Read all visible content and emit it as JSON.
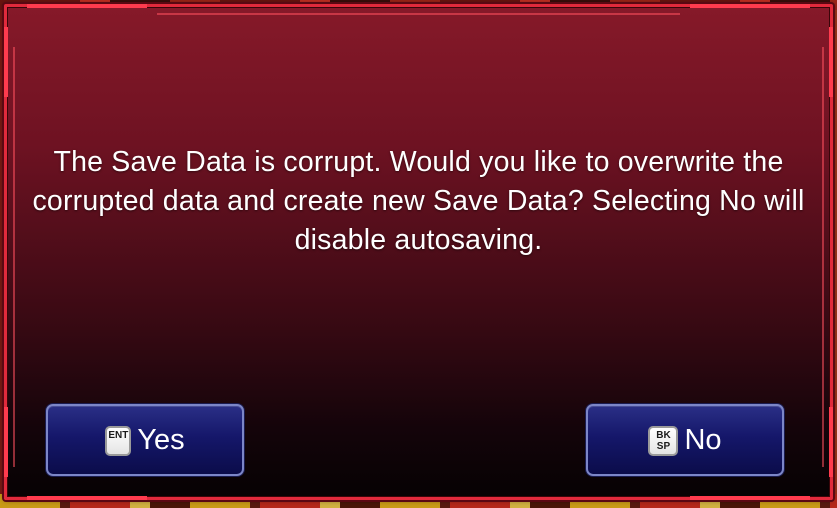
{
  "dialog": {
    "message": "The Save Data is corrupt. Would you like to overwrite the corrupted data and create new Save Data? Selecting No will disable autosaving.",
    "buttons": {
      "yes": {
        "label": "Yes",
        "key_hint": [
          "ENT"
        ],
        "icon": "enter-key-icon"
      },
      "no": {
        "label": "No",
        "key_hint": [
          "BK",
          "SP"
        ],
        "icon": "backspace-key-icon"
      }
    }
  },
  "colors": {
    "frame": "#e12a3c",
    "panel_top": "#861929",
    "panel_bottom": "#060203",
    "button_fill": "#15176a",
    "button_border": "#7c86c8",
    "text": "#ffffff"
  }
}
